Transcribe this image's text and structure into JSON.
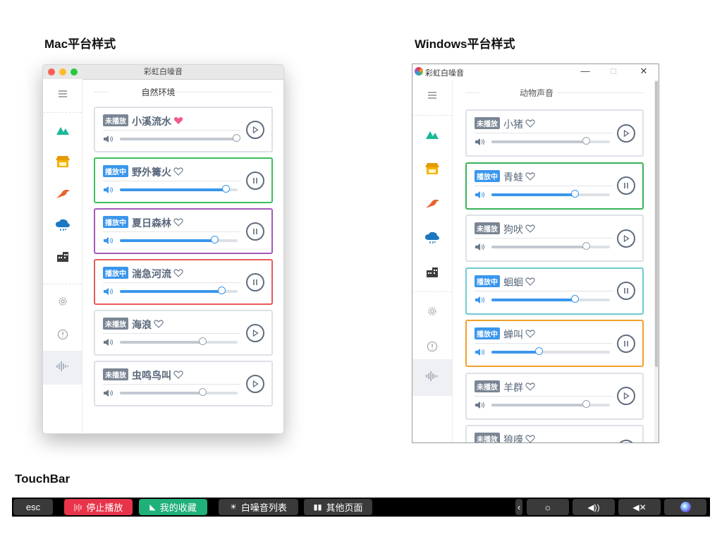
{
  "headings": {
    "mac": "Mac平台样式",
    "windows": "Windows平台样式",
    "touchbar": "TouchBar"
  },
  "mac_window": {
    "title": "彩虹白噪音",
    "group": "自然环境",
    "cards": [
      {
        "status": "未播放",
        "playing": false,
        "name": "小溪流水",
        "favorite": true,
        "volume": 0.99,
        "border": "#dde1e7"
      },
      {
        "status": "播放中",
        "playing": true,
        "name": "野外篝火",
        "favorite": false,
        "volume": 0.9,
        "border": "#3cbf5a"
      },
      {
        "status": "播放中",
        "playing": true,
        "name": "夏日森林",
        "favorite": false,
        "volume": 0.8,
        "border": "#a35aba"
      },
      {
        "status": "播放中",
        "playing": true,
        "name": "湍急河流",
        "favorite": false,
        "volume": 0.86,
        "border": "#e85a5a"
      },
      {
        "status": "未播放",
        "playing": false,
        "name": "海浪",
        "favorite": false,
        "volume": 0.7,
        "border": "#dde1e7"
      },
      {
        "status": "未播放",
        "playing": false,
        "name": "虫鸣鸟叫",
        "favorite": false,
        "volume": 0.7,
        "border": "#dde1e7"
      }
    ]
  },
  "windows_window": {
    "title": "彩虹白噪音",
    "controls": {
      "minimize": "—",
      "maximize": "□",
      "close": "✕"
    },
    "group": "动物声音",
    "cards": [
      {
        "status": "未播放",
        "playing": false,
        "name": "小猪",
        "favorite": false,
        "volume": 0.8,
        "border": "#dde1e7"
      },
      {
        "status": "播放中",
        "playing": true,
        "name": "青蛙",
        "favorite": false,
        "volume": 0.7,
        "border": "#37b45a"
      },
      {
        "status": "未播放",
        "playing": false,
        "name": "狗吠",
        "favorite": false,
        "volume": 0.8,
        "border": "#dde1e7"
      },
      {
        "status": "播放中",
        "playing": true,
        "name": "蛔蛔",
        "favorite": false,
        "volume": 0.7,
        "border": "#6ecbcf"
      },
      {
        "status": "播放中",
        "playing": true,
        "name": "蝉叫",
        "favorite": false,
        "volume": 0.4,
        "border": "#f2a02a"
      },
      {
        "status": "未播放",
        "playing": false,
        "name": "羊群",
        "favorite": false,
        "volume": 0.8,
        "border": "#dde1e7"
      },
      {
        "status": "未播放",
        "playing": false,
        "name": "狼嚎",
        "favorite": false,
        "volume": 0.8,
        "border": "#dde1e7"
      }
    ]
  },
  "sidebar_icons": [
    "menu-icon",
    "mountain-icon",
    "shop-icon",
    "bird-icon",
    "rain-cloud-icon",
    "building-icon",
    "gear-icon",
    "info-icon",
    "soundwave-icon"
  ],
  "touchbar": {
    "esc": "esc",
    "stop_play": "停止播放",
    "my_favorites": "我的收藏",
    "noise_list": "白噪音列表",
    "other_pages": "其他页面"
  },
  "colors": {
    "accent": "#3a96ec",
    "stop_button": "#e8344a",
    "favorites_button": "#20b07a",
    "heart_filled": "#f05c8c"
  }
}
